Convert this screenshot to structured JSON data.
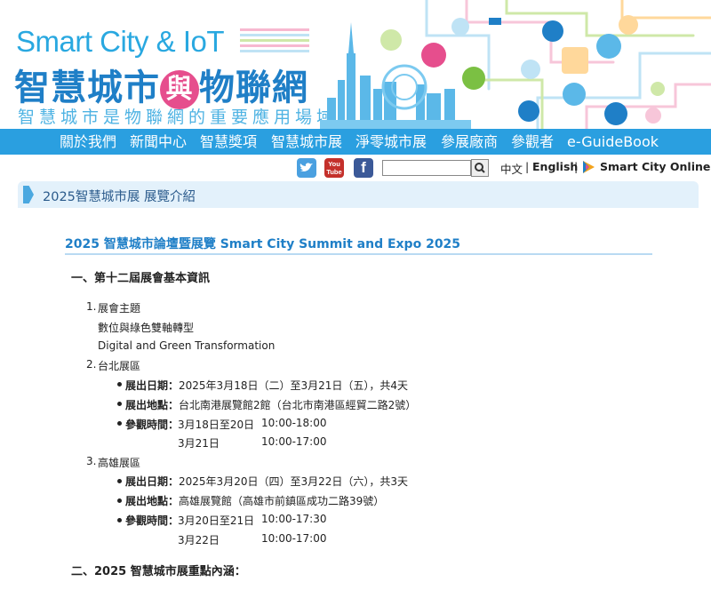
{
  "banner": {
    "logo_en": "Smart City & IoT",
    "logo_zh_a": "智慧城市",
    "logo_zh_yu": "與",
    "logo_zh_b": "物聯網",
    "tagline": "智慧城市是物聯網的重要應用場域",
    "colors": {
      "brand_blue": "#1f7fc7",
      "light_blue": "#29a8e0",
      "pink": "#e64e8d"
    }
  },
  "nav": {
    "items": [
      "關於我們",
      "新聞中心",
      "智慧獎項",
      "智慧城市展",
      "淨零城市展",
      "參展廠商",
      "參觀者",
      "e-GuideBook"
    ],
    "bg_color": "#2a9fe0"
  },
  "toolbar": {
    "social": [
      "twitter-icon",
      "youtube-icon",
      "facebook-icon"
    ],
    "youtube_label": "You Tube",
    "search": {
      "value": "",
      "placeholder": ""
    },
    "lang_zh": "中文",
    "lang_sep": "|",
    "lang_en": "English",
    "online_label": "Smart City Online"
  },
  "breadcrumb": {
    "text": "2025智慧城市展 展覽介紹"
  },
  "article": {
    "title": "2025 智慧城市論壇暨展覽 Smart City Summit and Expo 2025",
    "section1": "一、第十二屆展會基本資訊",
    "theme": {
      "num": "1.",
      "heading": "展會主題",
      "zh": "數位與綠色雙軸轉型",
      "en": "Digital and Green Transformation"
    },
    "taipei": {
      "num": "2.",
      "heading": "台北展區",
      "date_label": "展出日期：",
      "date": "2025年3月18日（二）至3月21日（五），共4天",
      "venue_label": "展出地點：",
      "venue": "台北南港展覽館2館（台北市南港區經貿二路2號）",
      "hours_label": "參觀時間：",
      "hours1_date": "3月18日至20日",
      "hours1_time": "10:00-18:00",
      "hours2_date": "3月21日",
      "hours2_time": "10:00-17:00"
    },
    "kaohsiung": {
      "num": "3.",
      "heading": "高雄展區",
      "date_label": "展出日期：",
      "date": "2025年3月20日（四）至3月22日（六），共3天",
      "venue_label": "展出地點：",
      "venue": "高雄展覽館（高雄市前鎮區成功二路39號）",
      "hours_label": "參觀時間：",
      "hours1_date": "3月20日至21日",
      "hours1_time": "10:00-17:30",
      "hours2_date": "3月22日",
      "hours2_time": "10:00-17:00"
    },
    "section2": "二、2025 智慧城市展重點內涵："
  }
}
